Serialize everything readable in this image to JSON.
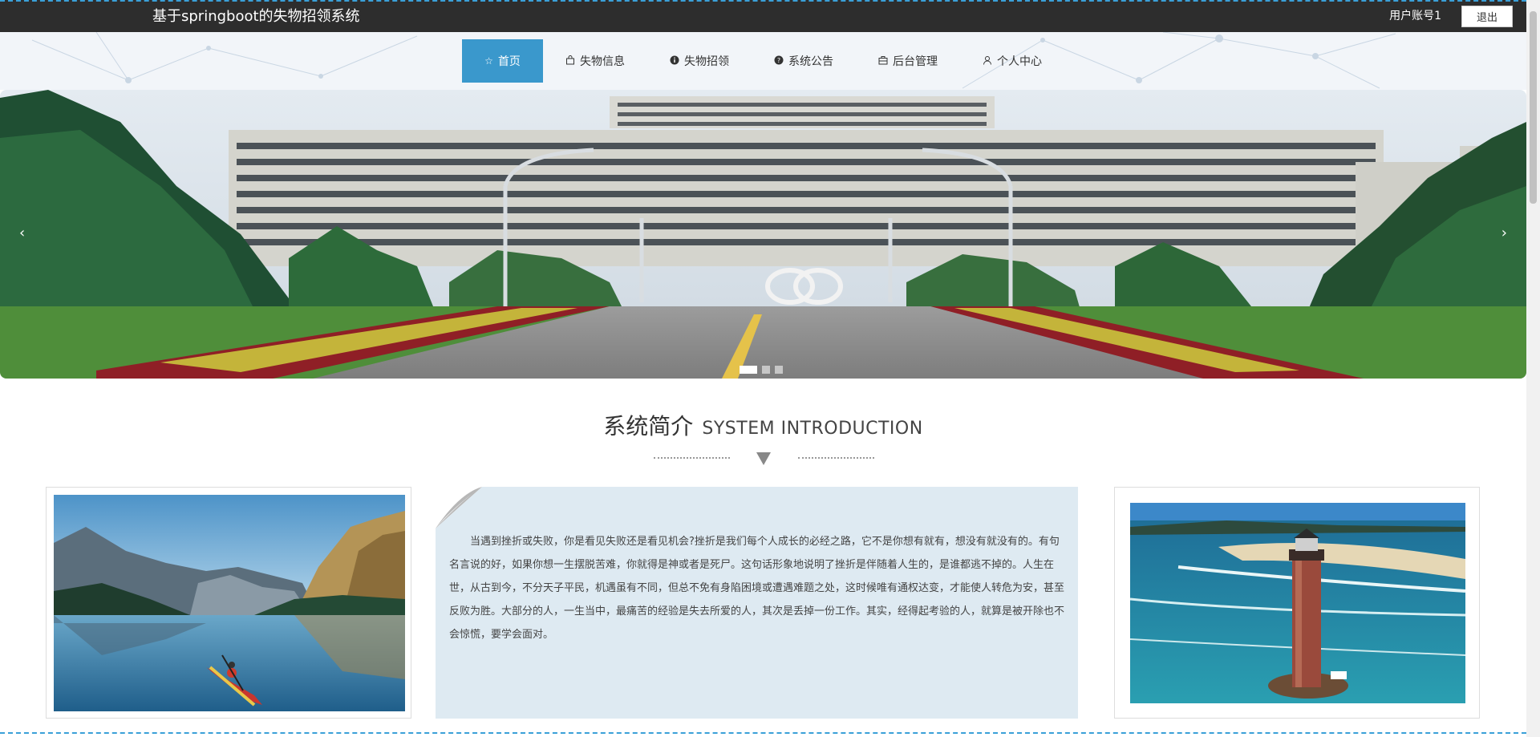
{
  "header": {
    "site_title": "基于springboot的失物招领系统",
    "account": "用户账号1",
    "logout_label": "退出"
  },
  "nav": {
    "items": [
      {
        "label": "首页",
        "icon": "star-icon",
        "active": true
      },
      {
        "label": "失物信息",
        "icon": "bag-icon"
      },
      {
        "label": "失物招领",
        "icon": "info-circle-icon"
      },
      {
        "label": "系统公告",
        "icon": "question-circle-icon"
      },
      {
        "label": "后台管理",
        "icon": "briefcase-icon"
      },
      {
        "label": "个人中心",
        "icon": "user-icon"
      }
    ]
  },
  "banner": {
    "prev_arrow": "‹",
    "next_arrow": "›",
    "slide_count": 3,
    "active_slide": 1
  },
  "intro": {
    "title_cn": "系统简介",
    "title_en": "SYSTEM INTRODUCTION",
    "text": "当遇到挫折或失败，你是看见失败还是看见机会?挫折是我们每个人成长的必经之路，它不是你想有就有，想没有就没有的。有句名言说的好，如果你想一生摆脱苦难，你就得是神或者是死尸。这句话形象地说明了挫折是伴随着人生的，是谁都逃不掉的。人生在世，从古到今，不分天子平民，机遇虽有不同，但总不免有身陷困境或遭遇难题之处，这时候唯有通权达变，才能使人转危为安，甚至反败为胜。大部分的人，一生当中，最痛苦的经验是失去所爱的人，其次是丢掉一份工作。其实，经得起考验的人，就算是被开除也不会惊慌，要学会面对。"
  },
  "colors": {
    "topbar": "#2d2d2d",
    "accent": "#3a98cc",
    "text_box_bg": "#deeaf2"
  }
}
